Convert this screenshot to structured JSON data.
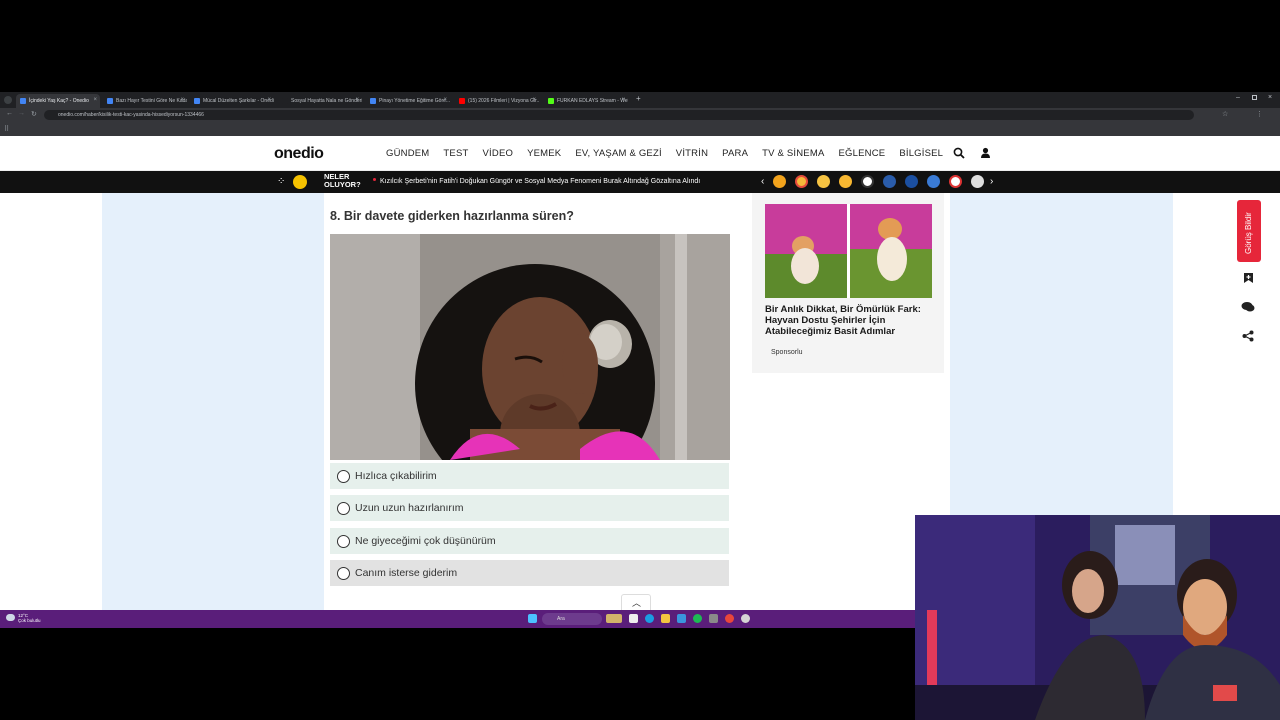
{
  "browser": {
    "tabs": [
      {
        "title": "İçindeki Yaş Kaç? - Onedio",
        "active": true,
        "fav": "#4285f4"
      },
      {
        "title": "Bazı Hayır Testini Göre Ne Kadar...",
        "active": false,
        "fav": "#4285f4"
      },
      {
        "title": "Mücal Düzelten Şarkılar - Onedio",
        "active": false,
        "fav": "#4285f4"
      },
      {
        "title": "Sosyal Hayatta Nala ne Gönderi...",
        "active": false,
        "fav": "#202124"
      },
      {
        "title": "Pinayı Yönetime Eğitime Göre...",
        "active": false,
        "fav": "#4285f4"
      },
      {
        "title": "(15) 2026 Filmleri | Vizyona Gir...",
        "active": false,
        "fav": "#ff0000"
      },
      {
        "title": "FURKAN EDLAYS Stream - Web...",
        "active": false,
        "fav": "#53fc18"
      }
    ],
    "url": "onedio.com/haber/kisilik-testi-kac-yasinda-hissediyorsun-1334466"
  },
  "site": {
    "logo": "onedio",
    "nav": [
      "GÜNDEM",
      "TEST",
      "VİDEO",
      "YEMEK",
      "EV, YAŞAM & GEZİ",
      "VİTRİN",
      "PARA",
      "TV & SİNEMA",
      "EĞLENCE",
      "BİLGİSEL"
    ],
    "ticker_label_1": "NELER",
    "ticker_label_2": "OLUYOR?",
    "ticker_headline": "Kızılcık Şerbeti'nin Fatih'i Doğukan Güngör ve Sosyal Medya Fenomeni Burak Altındağ Gözaltına Alındı"
  },
  "quiz": {
    "question": "8. Bir davete giderken hazırlanma süren?",
    "options": [
      "Hızlıca çıkabilirim",
      "Uzun uzun hazırlanırım",
      "Ne giyeceğimi çok düşünürüm",
      "Canım isterse giderim"
    ]
  },
  "sidebar": {
    "card_title": "Bir Anlık Dikkat, Bir Ömürlük Fark: Hayvan Dostu Şehirler İçin Atabileceğimiz Basit Adımlar",
    "sponsor_label": "Sponsorlu",
    "feedback_label": "Görüş Bildir"
  },
  "taskbar": {
    "temperature": "12°C",
    "weather": "Çok bulutlu",
    "search_placeholder": "Ara"
  },
  "colors": {
    "accent_red": "#e6263a",
    "option_bg": "#e6f0ec",
    "side_bg": "#e5f0fb"
  }
}
